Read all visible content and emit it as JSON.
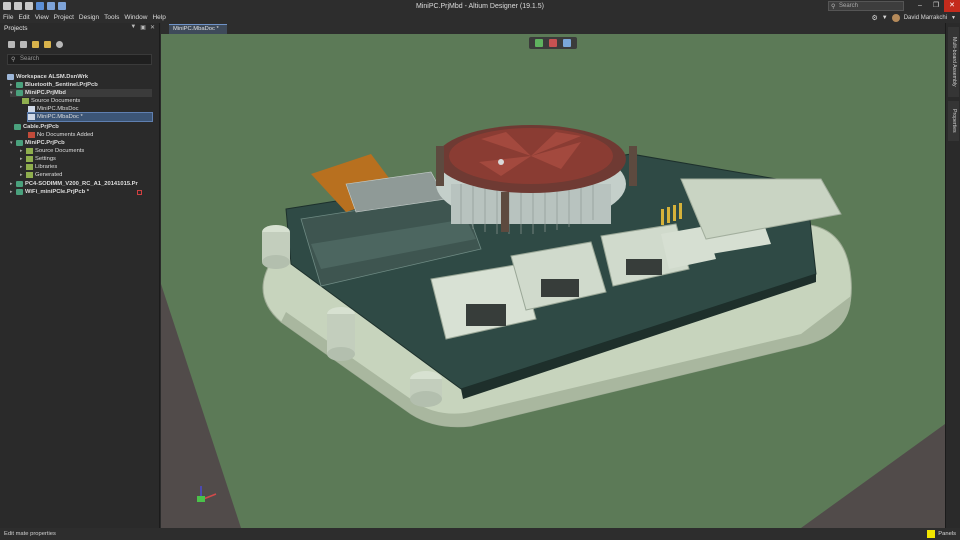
{
  "window": {
    "title": "MiniPC.PrjMbd - Altium Designer (19.1.5)",
    "search_placeholder": "Search",
    "user_name": "David Marrakchi"
  },
  "menu": [
    "File",
    "Edit",
    "View",
    "Project",
    "Design",
    "Tools",
    "Window",
    "Help"
  ],
  "projects_panel": {
    "title": "Projects",
    "search_placeholder": "Search",
    "tree": [
      {
        "label": "Workspace ALSM.DsnWrk",
        "level": 0,
        "bold": true,
        "icon": "workspace-icon"
      },
      {
        "label": "Bluetooth_Sentinel.PrjPcb",
        "level": 1,
        "bold": true,
        "icon": "pcb-project-icon"
      },
      {
        "label": "MiniPC.PrjMbd",
        "level": 1,
        "bold": true,
        "icon": "pcb-project-icon",
        "highlighted": true
      },
      {
        "label": "Source Documents",
        "level": 2,
        "icon": "folder-icon"
      },
      {
        "label": "MiniPC.MbsDoc",
        "level": 3,
        "icon": "document-icon"
      },
      {
        "label": "MiniPC.MbaDoc *",
        "level": 3,
        "icon": "document-icon",
        "selected": true
      },
      {
        "label": "Cable.PrjPcb",
        "level": 1,
        "bold": true,
        "icon": "pcb-project-icon"
      },
      {
        "label": "No Documents Added",
        "level": 2,
        "icon": "red-folder-icon"
      },
      {
        "label": "MiniPC.PrjPcb",
        "level": 1,
        "bold": true,
        "icon": "pcb-project-icon"
      },
      {
        "label": "Source Documents",
        "level": 2,
        "icon": "folder-icon"
      },
      {
        "label": "Settings",
        "level": 2,
        "icon": "folder-icon"
      },
      {
        "label": "Libraries",
        "level": 2,
        "icon": "folder-icon"
      },
      {
        "label": "Generated",
        "level": 2,
        "icon": "folder-icon"
      },
      {
        "label": "PC4-SODIMM_V200_RC_A1_20141015.Pr",
        "level": 1,
        "bold": true,
        "icon": "pcb-project-icon"
      },
      {
        "label": "WiFi_miniPCIe.PrjPcb *",
        "level": 1,
        "bold": true,
        "icon": "pcb-project-icon"
      }
    ]
  },
  "document_tab": {
    "label": "MiniPC.MbaDoc *"
  },
  "right_panels": [
    "Multi-board Assembly",
    "Properties"
  ],
  "status": {
    "message": "Edit mate properties",
    "panels_label": "Panels",
    "accent_color": "#f2e600"
  },
  "colors": {
    "viewport_background": "#5c7a57",
    "board_pcb": "#2f4a45",
    "enclosure": "#c9d6bf",
    "fan": "#8a3c33"
  }
}
